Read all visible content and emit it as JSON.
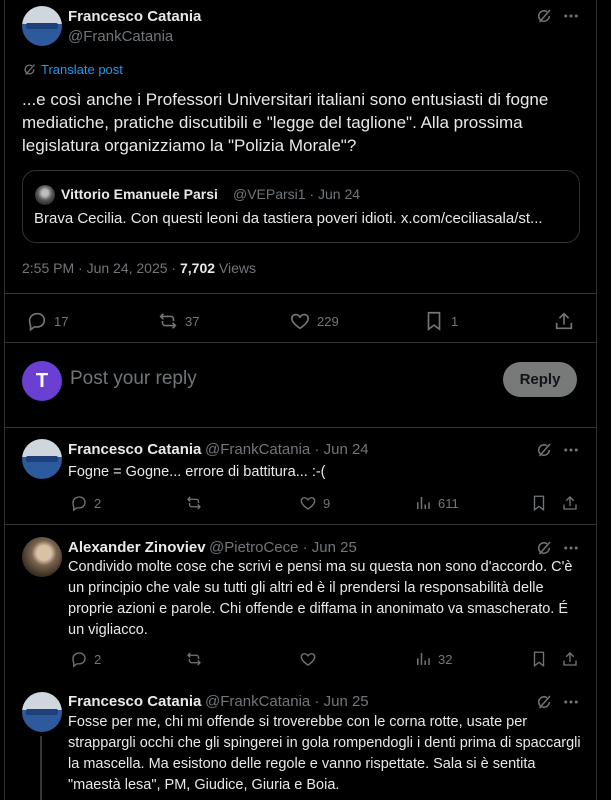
{
  "main_post": {
    "author_name": "Francesco Catania",
    "author_handle": "@FrankCatania",
    "translate_label": "Translate post",
    "text": "...e così anche i Professori Universitari italiani sono entusiasti di fogne mediatiche, pratiche discutibili e \"legge del taglione\". Alla prossima legislatura organizziamo la \"Polizia Morale\"?",
    "quote": {
      "author_name": "Vittorio Emanuele Parsi",
      "author_handle_date": "@VEParsi1 · Jun 24",
      "text": "Brava Cecilia. Con questi leoni da tastiera poveri idioti. x.com/ceciliasala/st..."
    },
    "timestamp": "2:55 PM · Jun 24, 2025 · ",
    "views_count": "7,702",
    "views_label": " Views",
    "actions": {
      "replies": "17",
      "reposts": "37",
      "likes": "229",
      "bookmarks": "1"
    }
  },
  "reply_box": {
    "avatar_letter": "T",
    "placeholder": "Post your reply",
    "button_label": "Reply"
  },
  "replies": [
    {
      "author_name": "Francesco Catania",
      "meta": "@FrankCatania · Jun 24",
      "text": "Fogne = Gogne... errore di battitura... :-(",
      "replies": "2",
      "likes": "9",
      "views": "611"
    },
    {
      "author_name": "Alexander Zinoviev",
      "meta": "@PietroCece · Jun 25",
      "text": "Condivido molte cose che scrivi e pensi ma su questa non sono d'accordo. C'è un principio che vale su tutti gli altri ed è il prendersi la responsabilità delle proprie azioni e parole. Chi offende e diffama in anonimato va smascherato. É un vigliacco.",
      "replies": "2",
      "likes": "",
      "views": "32"
    },
    {
      "author_name": "Francesco Catania",
      "meta": "@FrankCatania · Jun 25",
      "text": "Fosse per me, chi mi offende si troverebbe con le corna rotte, usate per strappargli occhi che gli spingerei in gola rompendogli i denti prima di spaccargli la mascella. Ma esistono delle regole e vanno rispettate. Sala si è sentita \"maestà lesa\", PM, Giudice, Giuria e Boia."
    }
  ],
  "colors": {
    "background": "#000000",
    "text": "#e7e9ea",
    "muted": "#71767b",
    "accent": "#1d9bf0",
    "border": "#2f3336",
    "avatar_t": "#6a3fd1"
  },
  "icons": [
    "grok-icon",
    "more-icon",
    "translate-icon",
    "reply-icon",
    "repost-icon",
    "like-icon",
    "bookmark-icon",
    "share-icon",
    "views-icon"
  ]
}
